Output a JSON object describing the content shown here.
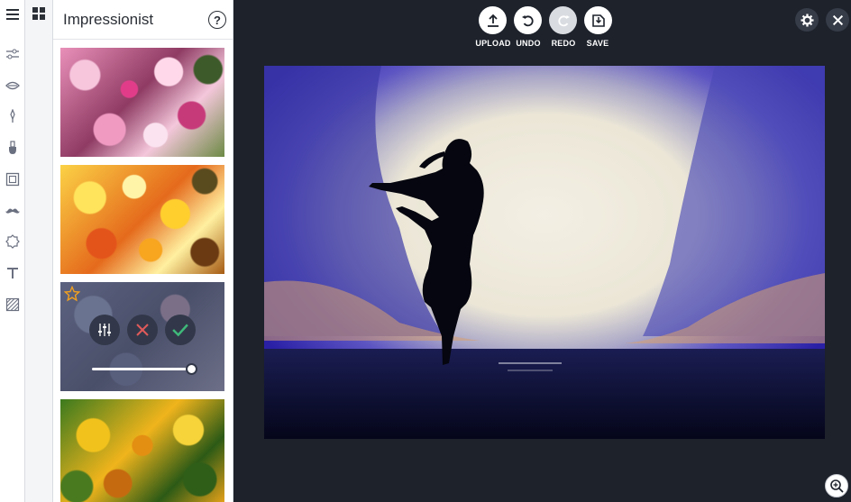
{
  "panel": {
    "title": "Impressionist",
    "help_label": "?"
  },
  "toolbar": {
    "upload_label": "UPLOAD",
    "undo_label": "UNDO",
    "redo_label": "REDO",
    "save_label": "SAVE"
  },
  "rail_icons": [
    "menu-icon",
    "sliders-icon",
    "eye-icon",
    "magic-wand-icon",
    "brush-icon",
    "frame-icon",
    "mustache-icon",
    "sticker-icon",
    "text-icon",
    "texture-icon"
  ],
  "effect_selected": {
    "intensity_percent": 100
  },
  "colors": {
    "background": "#1d222b",
    "panel": "#ffffff",
    "accept": "#3fb97a",
    "reject": "#e05a5a",
    "star": "#f0a020"
  }
}
